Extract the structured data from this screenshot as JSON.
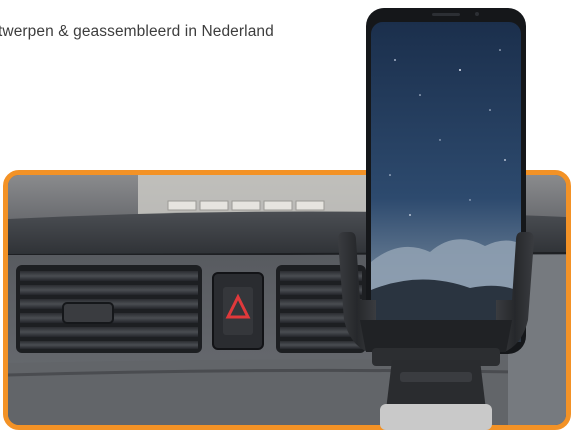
{
  "tagline": "twerpen & geassembleerd in Nederland",
  "colors": {
    "frame_border": "#f39226",
    "dashboard": "#55585d",
    "screen_sky": "#203a5a",
    "hazard_triangle": "#e0393b",
    "holder": "#2b2c2e"
  },
  "icons": {
    "hazard": "hazard-triangle-icon"
  }
}
